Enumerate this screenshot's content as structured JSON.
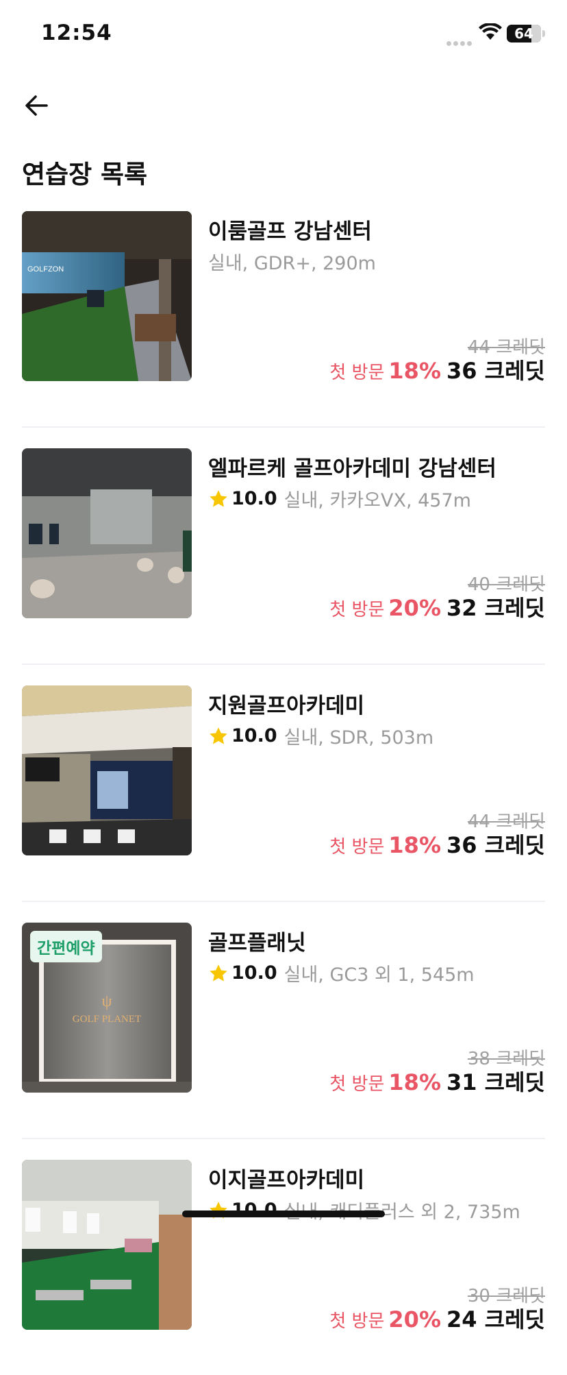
{
  "status_bar": {
    "time": "12:54",
    "battery": "64"
  },
  "header": {
    "title": "연습장 목록"
  },
  "venues": [
    {
      "name": "이룸골프 강남센터",
      "rating": "",
      "meta": "실내, GDR+, 290m",
      "badge": "",
      "original_price": "44 크레딧",
      "first_visit": "첫 방문",
      "discount": "18%",
      "final_price": "36 크레딧"
    },
    {
      "name": "엘파르케 골프아카데미 강남센터",
      "rating": "10.0",
      "meta": "실내, 카카오VX, 457m",
      "badge": "",
      "original_price": "40 크레딧",
      "first_visit": "첫 방문",
      "discount": "20%",
      "final_price": "32 크레딧"
    },
    {
      "name": "지원골프아카데미",
      "rating": "10.0",
      "meta": "실내, SDR, 503m",
      "badge": "",
      "original_price": "44 크레딧",
      "first_visit": "첫 방문",
      "discount": "18%",
      "final_price": "36 크레딧"
    },
    {
      "name": "골프플래닛",
      "rating": "10.0",
      "meta": "실내, GC3 외 1, 545m",
      "badge": "간편예약",
      "original_price": "38 크레딧",
      "first_visit": "첫 방문",
      "discount": "18%",
      "final_price": "31 크레딧"
    },
    {
      "name": "이지골프아카데미",
      "rating": "10.0",
      "meta": "실내, 캐디플러스 외 2, 735m",
      "badge": "",
      "original_price": "30 크레딧",
      "first_visit": "첫 방문",
      "discount": "20%",
      "final_price": "24 크레딧"
    }
  ],
  "colors": {
    "accent_discount": "#e95564",
    "star": "#f7c600",
    "badge_text": "#1e9e69",
    "badge_bg": "#e7f6ef"
  }
}
